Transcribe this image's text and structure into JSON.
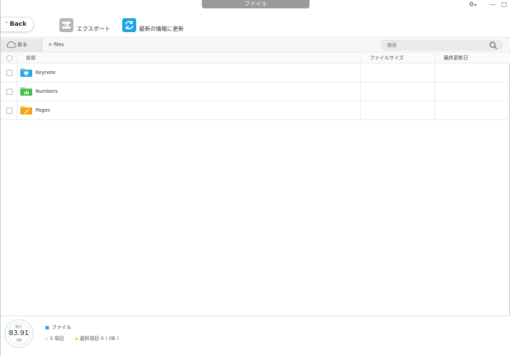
{
  "window": {
    "title": "ファイル",
    "controls": [
      "gear-icon",
      "minimize-icon",
      "maximize-icon"
    ]
  },
  "toolbar": {
    "back_label": "Back",
    "export_label": "エクスポート",
    "refresh_label": "最新の情報に更新"
  },
  "nav": {
    "back_label": "戻る",
    "path": "> files",
    "search_placeholder": "検索"
  },
  "table": {
    "columns": [
      "名前",
      "ファイルサイズ",
      "最終更新日"
    ],
    "rows": [
      {
        "name": "Keynote",
        "size": "",
        "modified": "",
        "icon": "keynote-folder-icon",
        "color": "#2aa6e6"
      },
      {
        "name": "Numbers",
        "size": "",
        "modified": "",
        "icon": "numbers-folder-icon",
        "color": "#3fbf4a"
      },
      {
        "name": "Pages",
        "size": "",
        "modified": "",
        "icon": "pages-folder-icon",
        "color": "#f4a417"
      }
    ]
  },
  "storage": {
    "label": "残り",
    "value": "83.91",
    "unit": "GB"
  },
  "footer": {
    "category": "ファイル",
    "item_count": "3 項目",
    "selected": "選択項目 0 ( 0B )"
  },
  "colors": {
    "accent": "#27a8e0",
    "selected_dot": "#f0b400"
  }
}
